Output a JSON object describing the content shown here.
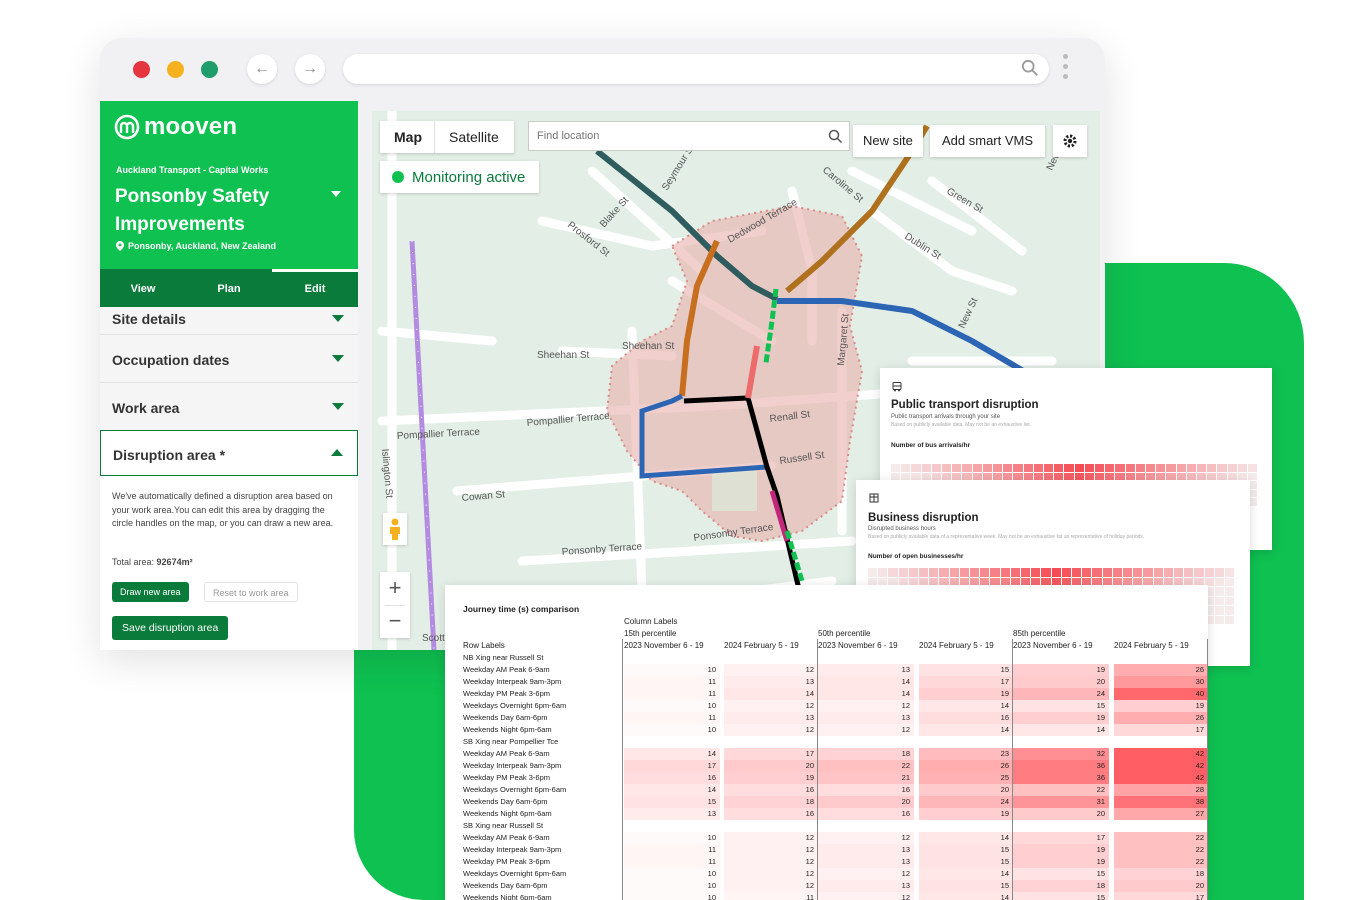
{
  "colors": {
    "brand_green": "#0fc151",
    "dark_green": "#0a7b3b"
  },
  "browser": {
    "url": ""
  },
  "sidebar": {
    "logo": "mooven",
    "org": "Auckland Transport - Capital Works",
    "project": "Ponsonby Safety Improvements",
    "location": "Ponsonby, Auckland, New Zealand",
    "tabs": [
      "View",
      "Plan",
      "Edit"
    ],
    "sections": [
      "Site details",
      "Occupation dates",
      "Work area",
      "Disruption area *"
    ],
    "description": "We've automatically defined a disruption area based on your work area.You can edit this area by dragging the circle handles on the map, or you can draw a new area.",
    "total_label": "Total area:",
    "total_value": "92674m²",
    "draw_button": "Draw new area",
    "reset_button": "Reset to work area",
    "save_button": "Save disruption area"
  },
  "map": {
    "type_map": "Map",
    "type_satellite": "Satellite",
    "search_placeholder": "Find location",
    "new_site": "New site",
    "add_vms": "Add smart VMS",
    "monitoring": "Monitoring active",
    "streets": [
      "Blake St",
      "Prosford St",
      "Sheehan St",
      "Sheehan St",
      "Pompallier Terrace",
      "Pompallier Terrace",
      "Cowan St",
      "Ponsonby Terrace",
      "Ponsonby Terrace",
      "Renall St",
      "Russell St",
      "Margaret St",
      "Dublin St",
      "Green St",
      "Caroline St",
      "Seymour St",
      "Dedwood Terrace",
      "New St",
      "Islington St",
      "New St",
      "Scott"
    ]
  },
  "pt_report": {
    "title": "Public transport disruption",
    "subtitle": "Public transport arrivals through your site",
    "note": "Based on publicly available data. May not be an exhaustive list.",
    "chart_label": "Number of bus arrivals/hr"
  },
  "biz_report": {
    "title": "Business disruption",
    "subtitle": "Disrupted business hours",
    "note": "Based on publicly available data of a representative week. May not be an exhaustive list as representative of holiday periods.",
    "chart_label": "Number of open businesses/hr"
  },
  "journey": {
    "title": "Journey time (s) comparison",
    "column_labels": "Column Labels",
    "row_labels": "Row Labels",
    "groups": [
      "15th percentile",
      "50th percentile",
      "85th percentile"
    ],
    "periods": [
      "2023 November 6 - 19",
      "2024 February 5 - 19"
    ],
    "rows": [
      {
        "label": "NB Xing near Russell St",
        "header": true,
        "v": []
      },
      {
        "label": "Weekday AM Peak 6-9am",
        "v": [
          10,
          12,
          13,
          15,
          19,
          26
        ]
      },
      {
        "label": "Weekday Interpeak 9am-3pm",
        "v": [
          11,
          13,
          14,
          17,
          20,
          30
        ]
      },
      {
        "label": "Weekday PM Peak 3-6pm",
        "v": [
          11,
          14,
          14,
          19,
          24,
          40
        ]
      },
      {
        "label": "Weekdays Overnight 6pm-6am",
        "v": [
          10,
          12,
          12,
          14,
          15,
          19
        ]
      },
      {
        "label": "Weekends Day 6am-6pm",
        "v": [
          11,
          13,
          13,
          16,
          19,
          26
        ]
      },
      {
        "label": "Weekends Night 6pm-6am",
        "v": [
          10,
          12,
          12,
          14,
          14,
          17
        ]
      },
      {
        "label": "SB Xing near Pompellier Tce",
        "header": true,
        "v": []
      },
      {
        "label": "Weekday AM Peak 6-9am",
        "v": [
          14,
          17,
          18,
          23,
          32,
          42
        ]
      },
      {
        "label": "Weekday Interpeak 9am-3pm",
        "v": [
          17,
          20,
          22,
          26,
          36,
          42
        ]
      },
      {
        "label": "Weekday PM Peak 3-6pm",
        "v": [
          16,
          19,
          21,
          25,
          36,
          42
        ]
      },
      {
        "label": "Weekdays Overnight 6pm-6am",
        "v": [
          14,
          16,
          16,
          20,
          22,
          28
        ]
      },
      {
        "label": "Weekends Day 6am-6pm",
        "v": [
          15,
          18,
          20,
          24,
          31,
          38
        ]
      },
      {
        "label": "Weekends Night 6pm-6am",
        "v": [
          13,
          16,
          16,
          19,
          20,
          27
        ]
      },
      {
        "label": "SB Xing near Russell St",
        "header": true,
        "v": []
      },
      {
        "label": "Weekday AM Peak 6-9am",
        "v": [
          10,
          12,
          12,
          14,
          17,
          22
        ]
      },
      {
        "label": "Weekday Interpeak 9am-3pm",
        "v": [
          11,
          12,
          13,
          15,
          19,
          22
        ]
      },
      {
        "label": "Weekday PM Peak 3-6pm",
        "v": [
          11,
          12,
          13,
          15,
          19,
          22
        ]
      },
      {
        "label": "Weekdays Overnight 6pm-6am",
        "v": [
          10,
          12,
          12,
          14,
          15,
          18
        ]
      },
      {
        "label": "Weekends Day 6am-6pm",
        "v": [
          10,
          12,
          13,
          15,
          18,
          20
        ]
      },
      {
        "label": "Weekends Night 6pm-6am",
        "v": [
          10,
          11,
          12,
          14,
          15,
          17
        ]
      }
    ]
  }
}
